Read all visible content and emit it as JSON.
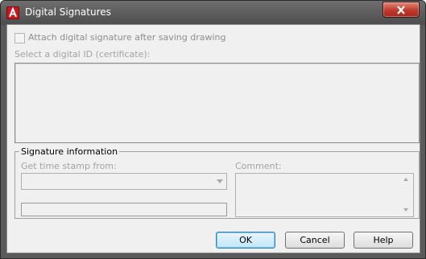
{
  "window": {
    "title": "Digital Signatures",
    "app_icon": "autocad-icon",
    "close_icon": "close-icon"
  },
  "signature": {
    "attach_label": "Attach digital signature after saving drawing",
    "attach_checked": false,
    "select_id_label": "Select a digital ID (certificate):",
    "certificates": []
  },
  "signature_info": {
    "group_title": "Signature information",
    "timestamp_label": "Get time stamp from:",
    "timestamp_value": "",
    "comment_label": "Comment:",
    "comment_value": ""
  },
  "buttons": {
    "ok": "OK",
    "cancel": "Cancel",
    "help": "Help"
  }
}
